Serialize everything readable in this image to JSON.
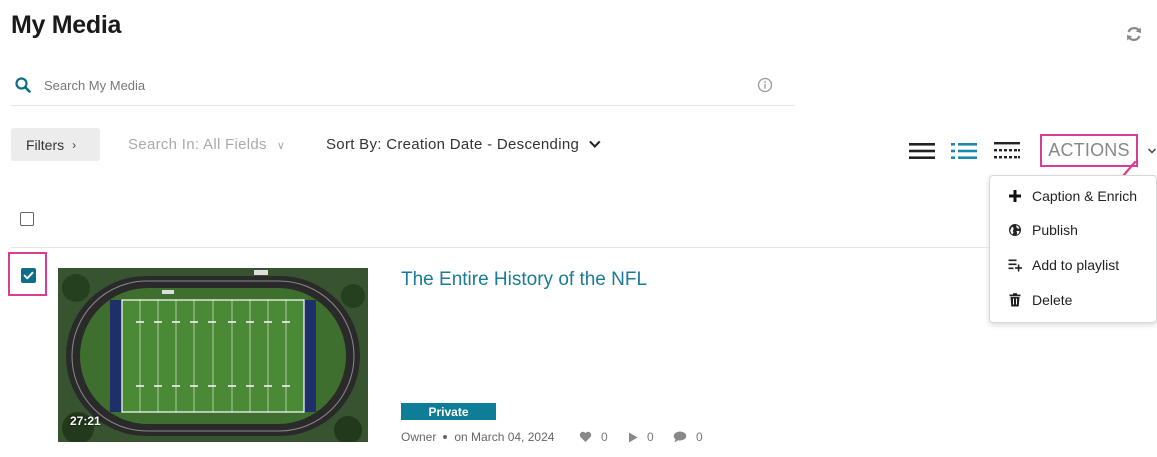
{
  "page": {
    "title": "My Media"
  },
  "search": {
    "placeholder": "Search My Media"
  },
  "toolbar": {
    "filters_label": "Filters",
    "search_in": "Search In: All Fields",
    "sort_by": "Sort By: Creation Date - Descending",
    "actions_label": "ACTIONS"
  },
  "actions_menu": [
    {
      "label": "Caption & Enrich",
      "icon": "plus-icon"
    },
    {
      "label": "Publish",
      "icon": "globe-icon"
    },
    {
      "label": "Add to playlist",
      "icon": "add-to-playlist-icon"
    },
    {
      "label": "Delete",
      "icon": "trash-icon"
    }
  ],
  "media": [
    {
      "title": "The Entire History of the NFL",
      "duration": "27:21",
      "status": "Private",
      "owner": "Owner",
      "date": "on March 04, 2024",
      "likes": "0",
      "plays": "0",
      "comments": "0",
      "selected": true
    }
  ],
  "colors": {
    "accent": "#0e7d97",
    "title_link": "#1a7a98",
    "highlight": "#d93d93"
  }
}
